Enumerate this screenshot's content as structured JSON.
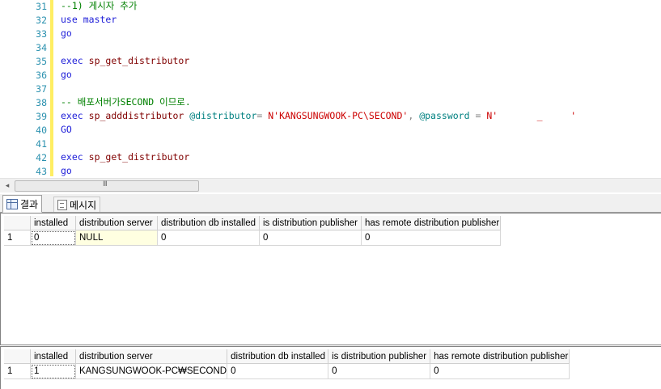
{
  "editor": {
    "lines": [
      {
        "num": "31",
        "segs": [
          {
            "t": "--1) 게시자 추가",
            "c": "cm"
          }
        ]
      },
      {
        "num": "32",
        "segs": [
          {
            "t": "use",
            "c": "kw"
          },
          {
            "t": " ",
            "c": ""
          },
          {
            "t": "master",
            "c": "kw"
          }
        ]
      },
      {
        "num": "33",
        "segs": [
          {
            "t": "go",
            "c": "kw"
          }
        ]
      },
      {
        "num": "34",
        "segs": []
      },
      {
        "num": "35",
        "segs": [
          {
            "t": "exec",
            "c": "kw"
          },
          {
            "t": " ",
            "c": ""
          },
          {
            "t": "sp_get_distributor",
            "c": "sp"
          }
        ]
      },
      {
        "num": "36",
        "segs": [
          {
            "t": "go",
            "c": "kw"
          }
        ]
      },
      {
        "num": "37",
        "segs": []
      },
      {
        "num": "38",
        "segs": [
          {
            "t": "-- 배포서버가SECOND 이므로.",
            "c": "cm"
          }
        ]
      },
      {
        "num": "39",
        "segs": [
          {
            "t": "exec",
            "c": "kw"
          },
          {
            "t": " ",
            "c": ""
          },
          {
            "t": "sp_adddistributor",
            "c": "sp"
          },
          {
            "t": " ",
            "c": ""
          },
          {
            "t": "@distributor",
            "c": "vr"
          },
          {
            "t": "=",
            "c": "op"
          },
          {
            "t": " N'KANGSUNGWOOK-PC\\SECOND'",
            "c": "st"
          },
          {
            "t": ",",
            "c": "op"
          },
          {
            "t": " ",
            "c": ""
          },
          {
            "t": "@password",
            "c": "vr"
          },
          {
            "t": " ",
            "c": ""
          },
          {
            "t": "=",
            "c": "op"
          },
          {
            "t": " N'",
            "c": "st"
          },
          {
            "t": "       ",
            "c": ""
          },
          {
            "t": "_",
            "c": "st"
          },
          {
            "t": "     ",
            "c": ""
          },
          {
            "t": "'",
            "c": "st"
          }
        ]
      },
      {
        "num": "40",
        "segs": [
          {
            "t": "GO",
            "c": "kw"
          }
        ]
      },
      {
        "num": "41",
        "segs": []
      },
      {
        "num": "42",
        "segs": [
          {
            "t": "exec",
            "c": "kw"
          },
          {
            "t": " ",
            "c": ""
          },
          {
            "t": "sp_get_distributor",
            "c": "sp"
          }
        ]
      },
      {
        "num": "43",
        "segs": [
          {
            "t": "go",
            "c": "kw"
          }
        ]
      }
    ]
  },
  "scrollbar": {
    "left_arrow": "◂",
    "grip": "III"
  },
  "tabs": {
    "results": "결과",
    "messages": "메시지"
  },
  "result1": {
    "headers": [
      "installed",
      "distribution server",
      "distribution db installed",
      "is distribution publisher",
      "has remote distribution publisher"
    ],
    "rows": [
      {
        "num": "1",
        "cells": [
          "0",
          "NULL",
          "0",
          "0",
          "0"
        ]
      }
    ]
  },
  "result2": {
    "headers": [
      "installed",
      "distribution server",
      "distribution db installed",
      "is distribution publisher",
      "has remote distribution publisher"
    ],
    "rows": [
      {
        "num": "1",
        "cells": [
          "1",
          "KANGSUNGWOOK-PC₩SECOND",
          "0",
          "0",
          "0"
        ]
      }
    ]
  }
}
